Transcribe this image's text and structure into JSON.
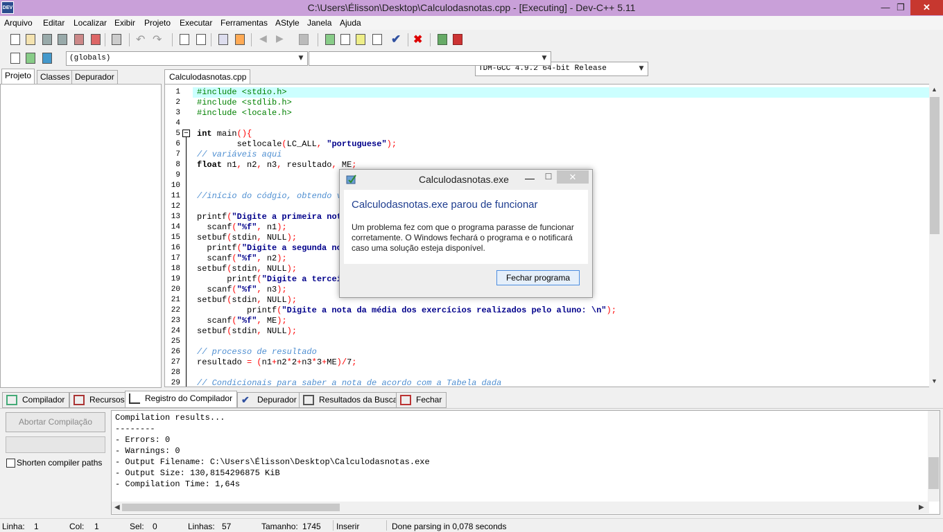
{
  "window": {
    "title": "C:\\Users\\Élisson\\Desktop\\Calculodasnotas.cpp - [Executing] - Dev-C++ 5.11",
    "app_icon_text": "DEV",
    "minimize": "—",
    "maximize": "❐",
    "close": "✕"
  },
  "menu": [
    "Arquivo",
    "Editar",
    "Localizar",
    "Exibir",
    "Projeto",
    "Executar",
    "Ferramentas",
    "AStyle",
    "Janela",
    "Ajuda"
  ],
  "toolbar": {
    "compiler_select": "TDM-GCC 4.9.2 64-bit Release",
    "scope_select": "(globals)",
    "member_select": ""
  },
  "left_tabs": [
    "Projeto",
    "Classes",
    "Depurador"
  ],
  "editor": {
    "file_tab": "Calculodasnotas.cpp",
    "line_numbers": [
      "1",
      "2",
      "3",
      "4",
      "5",
      "6",
      "7",
      "8",
      "9",
      "10",
      "11",
      "12",
      "13",
      "14",
      "15",
      "16",
      "17",
      "18",
      "19",
      "20",
      "21",
      "22",
      "23",
      "24",
      "25",
      "26",
      "27",
      "28",
      "29"
    ],
    "fold_marker": "−"
  },
  "bottom_tabs": [
    "Compilador",
    "Recursos",
    "Registro do Compilador",
    "Depurador",
    "Resultados da Busca",
    "Fechar"
  ],
  "compiler_panel": {
    "abort_button": "Abortar Compilação",
    "shorten_paths_label": "Shorten compiler paths",
    "output_lines": [
      "Compilation results...",
      "--------",
      "- Errors: 0",
      "- Warnings: 0",
      "- Output Filename: C:\\Users\\Élisson\\Desktop\\Calculodasnotas.exe",
      "- Output Size: 130,8154296875 KiB",
      "- Compilation Time: 1,64s"
    ]
  },
  "status": {
    "line_label": "Linha:",
    "line_value": "1",
    "col_label": "Col:",
    "col_value": "1",
    "sel_label": "Sel:",
    "sel_value": "0",
    "lines_label": "Linhas:",
    "lines_value": "57",
    "size_label": "Tamanho:",
    "size_value": "1745",
    "mode": "Inserir",
    "parse_msg": "Done parsing in 0,078 seconds"
  },
  "dialog": {
    "title": "Calculodasnotas.exe",
    "heading": "Calculodasnotas.exe parou de funcionar",
    "body": "Um problema fez com que o programa parasse de funcionar corretamente. O Windows fechará o programa e o notificará caso uma solução esteja disponível.",
    "button": "Fechar programa",
    "minimize": "—",
    "maximize": "☐",
    "close": "✕"
  }
}
